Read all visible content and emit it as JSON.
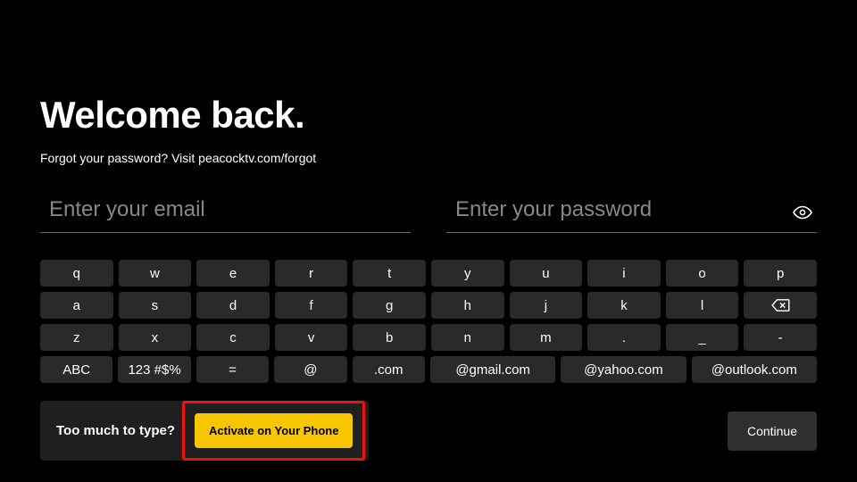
{
  "title": "Welcome back.",
  "subtitle": "Forgot your password? Visit peacocktv.com/forgot",
  "fields": {
    "email_placeholder": "Enter your email",
    "email_value": "",
    "password_placeholder": "Enter your password",
    "password_value": ""
  },
  "keyboard": {
    "row0": [
      "q",
      "w",
      "e",
      "r",
      "t",
      "y",
      "u",
      "i",
      "o",
      "p"
    ],
    "row1": [
      "a",
      "s",
      "d",
      "f",
      "g",
      "h",
      "j",
      "k",
      "l"
    ],
    "row2": [
      "z",
      "x",
      "c",
      "v",
      "b",
      "n",
      "m",
      ".",
      "_",
      "-"
    ],
    "row3_fixed": [
      "ABC",
      "123 #$%",
      "=",
      "@",
      ".com"
    ],
    "row3_flex": [
      "@gmail.com",
      "@yahoo.com",
      "@outlook.com"
    ]
  },
  "promo": {
    "text": "Too much to type?",
    "cta": "Activate on Your Phone"
  },
  "continue_label": "Continue",
  "colors": {
    "accent": "#f7c600",
    "highlight": "#e11"
  }
}
